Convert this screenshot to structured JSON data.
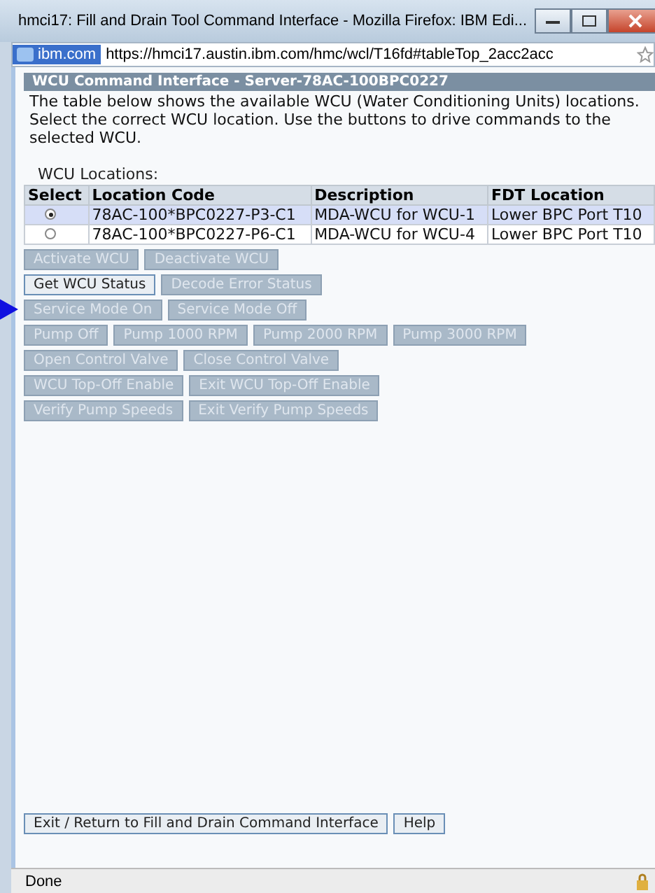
{
  "window": {
    "title": "hmci17: Fill and Drain Tool Command Interface - Mozilla Firefox: IBM Edi..."
  },
  "address_bar": {
    "site": "ibm.com",
    "url": "https://hmci17.austin.ibm.com/hmc/wcl/T16fd#tableTop_2acc2acc"
  },
  "panel": {
    "title": "WCU Command Interface - Server-78AC-100BPC0227",
    "description": "The table below shows the available WCU (Water Conditioning Units) locations. Select the correct WCU location. Use the buttons to drive commands to the selected WCU."
  },
  "table": {
    "caption": "WCU Locations:",
    "columns": [
      "Select",
      "Location Code",
      "Description",
      "FDT Location"
    ],
    "rows": [
      {
        "selected": true,
        "location_code": "78AC-100*BPC0227-P3-C1",
        "description": "MDA-WCU for WCU-1",
        "fdt_location": "Lower BPC Port T10"
      },
      {
        "selected": false,
        "location_code": "78AC-100*BPC0227-P6-C1",
        "description": "MDA-WCU for WCU-4",
        "fdt_location": "Lower BPC Port T10"
      }
    ]
  },
  "button_rows": [
    {
      "pointer": false,
      "buttons": [
        {
          "label": "Activate WCU",
          "disabled": true
        },
        {
          "label": "Deactivate WCU",
          "disabled": true
        }
      ]
    },
    {
      "pointer": false,
      "buttons": [
        {
          "label": "Get WCU Status",
          "disabled": false
        },
        {
          "label": "Decode Error Status",
          "disabled": true
        }
      ]
    },
    {
      "pointer": true,
      "buttons": [
        {
          "label": "Service Mode On",
          "disabled": true
        },
        {
          "label": "Service Mode Off",
          "disabled": true
        }
      ]
    },
    {
      "pointer": false,
      "buttons": [
        {
          "label": "Pump Off",
          "disabled": true
        },
        {
          "label": "Pump 1000 RPM",
          "disabled": true
        },
        {
          "label": "Pump 2000 RPM",
          "disabled": true
        },
        {
          "label": "Pump 3000 RPM",
          "disabled": true
        }
      ]
    },
    {
      "pointer": false,
      "buttons": [
        {
          "label": "Open Control Valve",
          "disabled": true
        },
        {
          "label": "Close Control Valve",
          "disabled": true
        }
      ]
    },
    {
      "pointer": false,
      "buttons": [
        {
          "label": "WCU Top-Off Enable",
          "disabled": true
        },
        {
          "label": "Exit WCU Top-Off Enable",
          "disabled": true
        }
      ]
    },
    {
      "pointer": false,
      "buttons": [
        {
          "label": "Verify Pump Speeds",
          "disabled": true
        },
        {
          "label": "Exit Verify Pump Speeds",
          "disabled": true
        }
      ]
    }
  ],
  "footer_buttons": [
    {
      "label": "Exit / Return to Fill and Drain Command Interface",
      "disabled": false
    },
    {
      "label": "Help",
      "disabled": false
    }
  ],
  "status_bar": {
    "text": "Done"
  }
}
